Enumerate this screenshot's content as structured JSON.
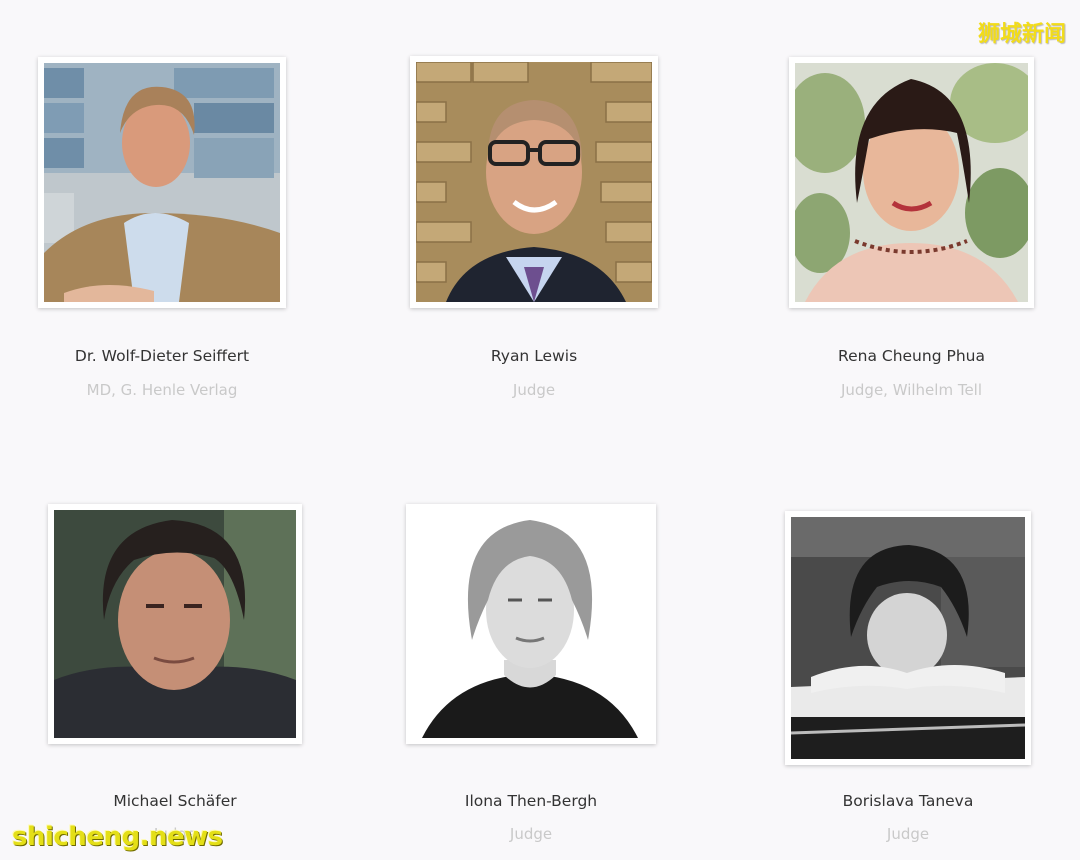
{
  "watermark_top": "狮城新闻",
  "watermark_bottom": "shicheng.news",
  "judges": [
    {
      "name": "Dr. Wolf-Dieter Seiffert",
      "role": "MD, G. Henle Verlag"
    },
    {
      "name": "Ryan Lewis",
      "role": "Judge"
    },
    {
      "name": "Rena Cheung Phua",
      "role": "Judge, Wilhelm Tell"
    },
    {
      "name": "Michael Schäfer",
      "role": "Judge"
    },
    {
      "name": "Ilona Then-Bergh",
      "role": "Judge"
    },
    {
      "name": "Borislava Taneva",
      "role": "Judge"
    }
  ],
  "colors": {
    "background": "#f9f8fa",
    "name_text": "#333333",
    "role_text": "#c9c9c9",
    "watermark": "#f2dc1a"
  }
}
